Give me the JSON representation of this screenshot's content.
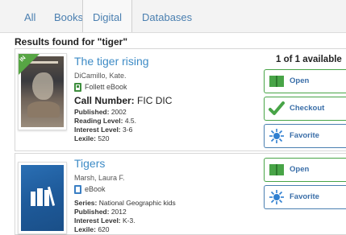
{
  "tabs": [
    {
      "label": "All"
    },
    {
      "label": "Books"
    },
    {
      "label": "Digital"
    },
    {
      "label": "Databases"
    }
  ],
  "results_header": "Results found for \"tiger\"",
  "availability": "1 of 1 available",
  "items": [
    {
      "ribbon": "IN",
      "title": "The tiger rising",
      "author": "DiCamillo, Kate.",
      "format": "Follett eBook",
      "call_label": "Call Number:",
      "call_value": "FIC DIC",
      "published_label": "Published:",
      "published": "2002",
      "reading_label": "Reading Level:",
      "reading": "4.5.",
      "interest_label": "Interest Level:",
      "interest": "3-6",
      "lexile_label": "Lexile:",
      "lexile": "520"
    },
    {
      "title": "Tigers",
      "author": "Marsh, Laura F.",
      "format": "eBook",
      "series_label": "Series:",
      "series": "National Geographic kids",
      "published_label": "Published:",
      "published": "2012",
      "interest_label": "Interest Level:",
      "interest": "K-3.",
      "lexile_label": "Lexile:",
      "lexile": "620"
    }
  ],
  "buttons": {
    "open": "Open",
    "checkout": "Checkout",
    "favorite": "Favorite"
  },
  "colors": {
    "accent_blue": "#3d8bc6",
    "green": "#48a447",
    "star_blue": "#2f7fd0"
  }
}
